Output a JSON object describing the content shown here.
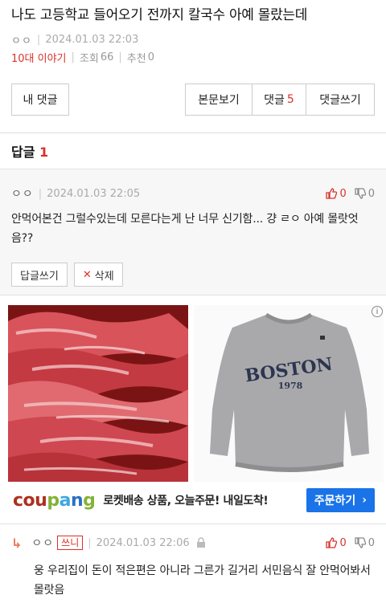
{
  "post": {
    "title": "나도 고등학교 들어오기 전까지 칼국수 아예 몰랐는데",
    "author": "ㅇㅇ",
    "date": "2024.01.03 22:03",
    "category": "10대 이야기",
    "views_label": "조회",
    "views": "66",
    "recommend_label": "추천",
    "recommend": "0"
  },
  "buttons": {
    "my_comments": "내 댓글",
    "view_post": "본문보기",
    "comments_label": "댓글",
    "comments_count": "5",
    "write_comment": "댓글쓰기"
  },
  "replies_section": {
    "title": "답글",
    "count": "1"
  },
  "comment1": {
    "author": "ㅇㅇ",
    "date": "2024.01.03 22:05",
    "up": "0",
    "down": "0",
    "body": "안먹어본건 그럴수있는데 모른다는게 난 너무 신기함... 걍 ㄹㅇ 아예 몰랏엇음??",
    "reply_button": "답글쓰기",
    "delete_button": "삭제"
  },
  "ad": {
    "logo": [
      "cou",
      "p",
      "a",
      "n",
      "g"
    ],
    "text": "로켓배송 상품, 오늘주문! 내일도착!",
    "cta": "주문하기",
    "info": "i",
    "sweatshirt_text": "BOSTON",
    "sweatshirt_year": "1978"
  },
  "comment2": {
    "author": "ㅇㅇ",
    "badge": "쓰니",
    "date": "2024.01.03 22:06",
    "up": "0",
    "down": "0",
    "body": "웅 우리집이 돈이 적은편은 아니라 그른가 길거리 서민음식 잘 안먹어봐서 몰랏음"
  }
}
